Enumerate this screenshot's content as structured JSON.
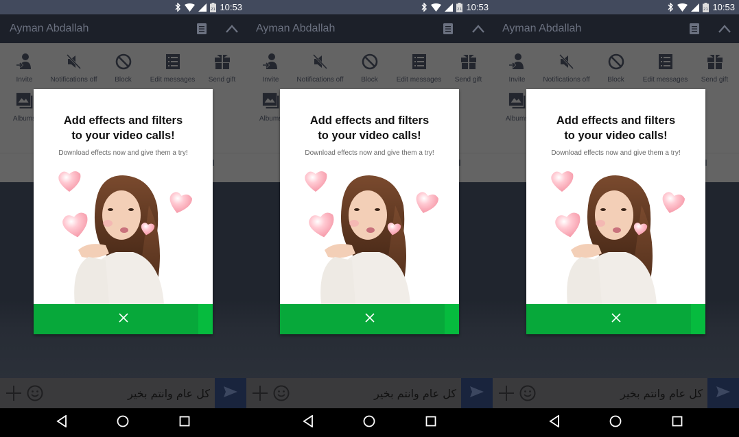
{
  "screens": [
    {
      "status_bar": {
        "time": "10:53",
        "icons": [
          "bluetooth-icon",
          "wifi-icon",
          "signal-icon",
          "battery-icon"
        ],
        "battery_label": "21"
      },
      "header": {
        "title": "Ayman Abdallah",
        "icons": [
          "note-icon",
          "chevron-up-icon"
        ]
      },
      "menu": {
        "items": [
          {
            "label": "Invite",
            "icon": "invite-icon"
          },
          {
            "label": "Notifications off",
            "icon": "notifications-off-icon"
          },
          {
            "label": "Block",
            "icon": "block-icon"
          },
          {
            "label": "Edit messages",
            "icon": "edit-messages-icon"
          },
          {
            "label": "Send gift",
            "icon": "gift-icon"
          }
        ],
        "row2": [
          {
            "label": "Albums",
            "icon": "album-icon"
          }
        ]
      },
      "modal": {
        "title_line1": "Add effects and filters",
        "title_line2": "to your video calls!",
        "subtitle": "Download effects now and give them a try!",
        "image": "woman-blowing-kiss-with-heart-effects",
        "close_icon": "close-icon"
      },
      "input": {
        "value": "كل عام وانتم بخير",
        "icons": [
          "plus-icon",
          "emoji-icon",
          "send-icon"
        ]
      },
      "nav": [
        "back-icon",
        "home-icon",
        "recents-icon"
      ]
    }
  ],
  "colors": {
    "status_bar": "#424a5d",
    "header": "#1c2029",
    "menu_dimmed": "#646464",
    "modal_button": "#07a83a",
    "send_button": "#19243d"
  }
}
